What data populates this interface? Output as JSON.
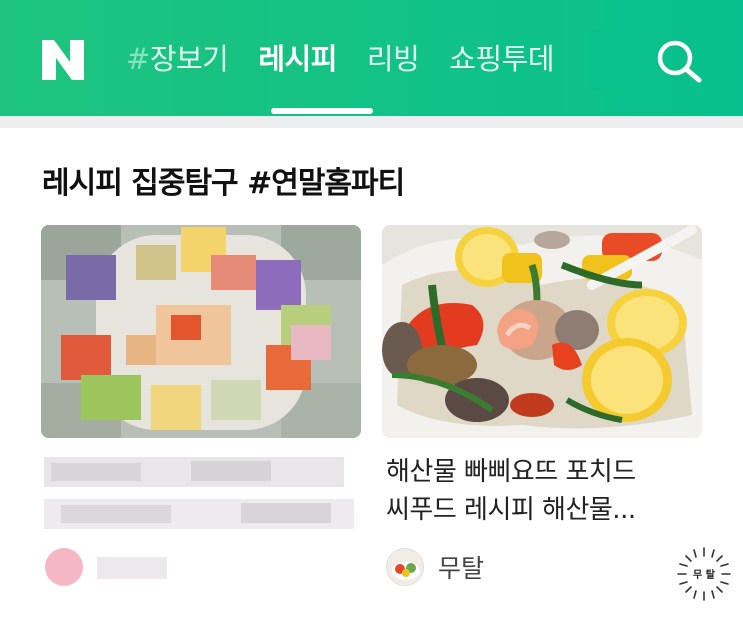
{
  "header": {
    "logo_letter": "N",
    "tabs": [
      {
        "label": "장보기",
        "hash": "#"
      },
      {
        "label": "레시피"
      },
      {
        "label": "리빙"
      },
      {
        "label": "쇼핑투데"
      }
    ],
    "active_tab_index": 1,
    "accent_color": "#09c18b"
  },
  "section": {
    "title": "레시피 집중탐구 #연말홈파티"
  },
  "cards": [
    {
      "title_blurred": true,
      "author_blurred": true
    },
    {
      "title_line1": "해산물 빠삐요뜨 포치드",
      "title_line2": "씨푸드 레시피 해산물...",
      "author": "무탈",
      "stamp_text": "무 탈"
    }
  ]
}
